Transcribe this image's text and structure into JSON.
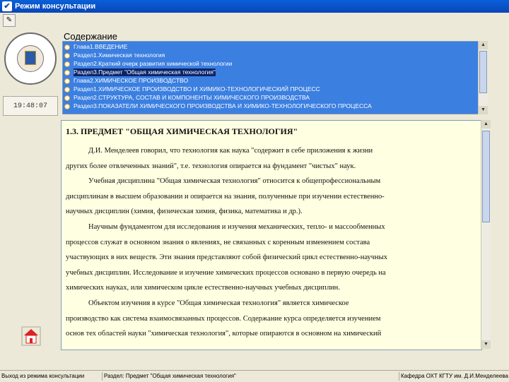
{
  "window": {
    "title": "Режим консультации"
  },
  "left": {
    "time": "19:48:07"
  },
  "toc": {
    "title": "Содержание",
    "items": [
      {
        "label": "Глава1.ВВЕДЕНИЕ",
        "selected": false
      },
      {
        "label": "Раздел1.Химическая технология",
        "selected": false
      },
      {
        "label": "Раздел2.Краткий очерк развития химической технологии",
        "selected": false
      },
      {
        "label": "Раздел3.Предмет \"Общая химическая технология\"",
        "selected": true
      },
      {
        "label": "Глава2.ХИМИЧЕСКОЕ ПРОИЗВОДСТВО",
        "selected": false
      },
      {
        "label": "Раздел1.ХИМИЧЕСКОЕ ПРОИЗВОДСТВО И ХИМИКО-ТЕХНОЛОГИЧЕСКИЙ ПРОЦЕСС",
        "selected": false
      },
      {
        "label": "Раздел2.СТРУКТУРА, СОСТАВ И КОМПОНЕНТЫ ХИМИЧЕСКОГО ПРОИЗВОДСТВА",
        "selected": false
      },
      {
        "label": "Раздел3.ПОКАЗАТЕЛИ ХИМИЧЕСКОГО ПРОИЗВОДСТВА И ХИМИКО-ТЕХНОЛОГИЧЕСКОГО ПРОЦЕССА",
        "selected": false
      }
    ]
  },
  "doc": {
    "heading": "1.3. ПРЕДМЕТ \"ОБЩАЯ ХИМИЧЕСКАЯ ТЕХНОЛОГИЯ\"",
    "lines": [
      {
        "text": "Д.И. Менделеев говорил, что технология как наука \"содержит в себе приложения к жизни",
        "indent": true
      },
      {
        "text": "других более отвлеченных знаний\", т.е. технология опирается на фундамент \"чистых\" наук.",
        "indent": false
      },
      {
        "text": "Учебная дисциплина \"Общая химическая технология\" относится к общепрофессиональным",
        "indent": true
      },
      {
        "text": "дисциплинам в высшем образовании и опирается на знания, полученные при изучении естественно-",
        "indent": false
      },
      {
        "text": "научных дисциплин (химия, физическая химия, физика, математика и др.).",
        "indent": false
      },
      {
        "text": "Научным фундаментом для исследования и изучения механических, тепло- и массообменных",
        "indent": true
      },
      {
        "text": "процессов служат в основном знания о явлениях, не связанных с коренным изменением состава",
        "indent": false
      },
      {
        "text": "участвующих в них веществ. Эти знания представляют собой физический цикл естественно-научных",
        "indent": false
      },
      {
        "text": "учебных дисциплин. Исследование и изучение химических процессов основано в первую очередь на",
        "indent": false
      },
      {
        "text": "химических науках, или химическом цикле естественно-научных учебных дисциплин.",
        "indent": false
      },
      {
        "text": "Объектом изучения в курсе \"Общая химическая технология\" является химическое",
        "indent": true
      },
      {
        "text": "производство как система взаимосвязанных процессов. Содержание курса определяется изучением",
        "indent": false
      },
      {
        "text": "основ тех областей науки \"химическая технология\", которые опираются в основном на химический",
        "indent": false
      }
    ]
  },
  "status": {
    "exit": "Выход из режима консультации",
    "section": "Раздел: Предмет \"Общая химическая технология\"",
    "dept": "Кафедра ОХТ КГТУ им. Д.И.Менделеева"
  },
  "scroll": {
    "toc_position": 0.1,
    "doc_position": 0.02
  }
}
